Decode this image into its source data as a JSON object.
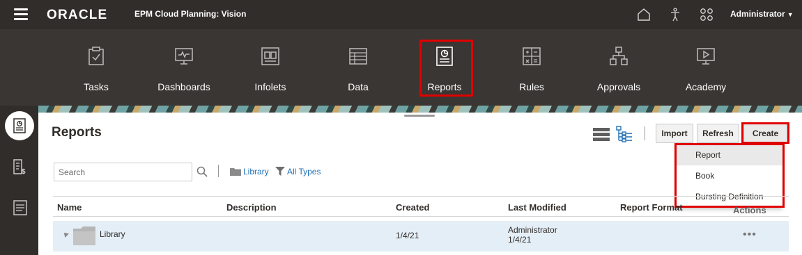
{
  "header": {
    "logo": "ORACLE",
    "app_title": "EPM Cloud Planning: Vision",
    "user": "Administrator",
    "icons": [
      "home-icon",
      "accessibility-icon",
      "navigator-icon"
    ]
  },
  "nav": {
    "items": [
      {
        "label": "Tasks",
        "icon": "tasks-icon"
      },
      {
        "label": "Dashboards",
        "icon": "dashboards-icon"
      },
      {
        "label": "Infolets",
        "icon": "infolets-icon"
      },
      {
        "label": "Data",
        "icon": "data-icon"
      },
      {
        "label": "Reports",
        "icon": "reports-icon",
        "active": true
      },
      {
        "label": "Rules",
        "icon": "rules-icon"
      },
      {
        "label": "Approvals",
        "icon": "approvals-icon"
      },
      {
        "label": "Academy",
        "icon": "academy-icon"
      }
    ]
  },
  "page": {
    "title": "Reports"
  },
  "toolbar": {
    "import_label": "Import",
    "refresh_label": "Refresh",
    "create_label": "Create"
  },
  "create_menu": {
    "items": [
      "Report",
      "Book",
      "Bursting Definition"
    ]
  },
  "search": {
    "placeholder": "Search"
  },
  "breadcrumb": {
    "library": "Library",
    "filter": "All Types"
  },
  "table": {
    "columns": [
      "Name",
      "Description",
      "Created",
      "Last Modified",
      "Report Format",
      "Actions"
    ],
    "rows": [
      {
        "name": "Library",
        "description": "",
        "created": "1/4/21",
        "modified_by": "Administrator",
        "modified_date": "1/4/21",
        "format": "",
        "actions": "•••"
      }
    ]
  },
  "colors": {
    "header_bg": "#312d2a",
    "nav_bg": "#3a3633",
    "highlight_red": "#e00000",
    "link_blue": "#1f6fb5",
    "selected_row": "#e4eef7"
  }
}
